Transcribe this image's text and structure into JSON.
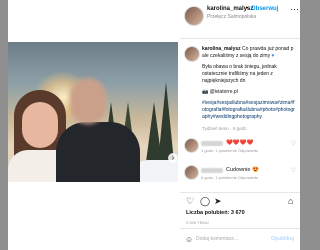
{
  "header": {
    "username": "karolina_malysz",
    "follow_label": "Obserwuj",
    "location": "Przełęcz Salmopolska",
    "more_icon": "more-icon"
  },
  "caption": {
    "username": "karolina_malysz",
    "line1": "Co prawda już ponad p",
    "line2": "ale czekaliśmy z sesją do zimy",
    "para2": "Była obawa o brak śniegu, jednak ostatecznie trafiliśmy na jeden z najpiękniejszych dn",
    "credit": "📷 @iviatorre.pl",
    "hashtags": "#sesja#sesjaślubna#sesjazimowa#zima#fotografia#fotografiaślubna#photo#photography#weddingphotography",
    "time": "Tydzień temu · 5 godz."
  },
  "comments": [
    {
      "text": "❤️❤️❤️❤️",
      "meta": "1 godz.   1 polubienie   Odpowiedz"
    },
    {
      "text": "Cudownie 😍",
      "meta": "6 godz.   1 polubienie   Odpowiedz"
    }
  ],
  "actions": {
    "like_icon": "heart-icon",
    "comment_icon": "comment-icon",
    "share_icon": "send-icon",
    "save_icon": "bookmark-icon"
  },
  "likes": "Liczba polubień: 3 670",
  "date": "2 DNI TEMU",
  "add_comment": {
    "placeholder": "Dodaj komentarz...",
    "publish_label": "Opublikuj"
  },
  "carousel": {
    "slide_count": 6,
    "active_index": 0
  }
}
